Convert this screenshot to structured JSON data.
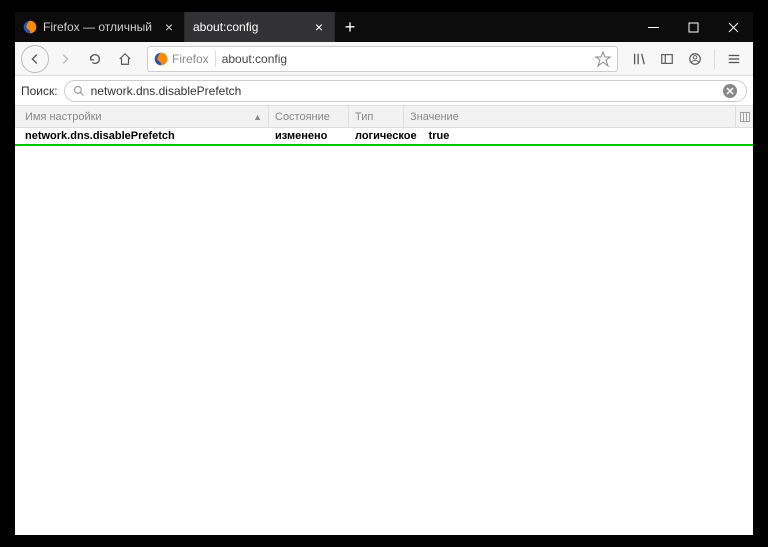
{
  "window": {
    "tabs": [
      {
        "title": "Firefox — отличный браузер",
        "favicon": "firefox"
      },
      {
        "title": "about:config",
        "favicon": "none"
      }
    ],
    "active_tab": 1
  },
  "navbar": {
    "url_identity": "Firefox",
    "url": "about:config"
  },
  "config": {
    "search_label": "Поиск:",
    "search_value": "network.dns.disablePrefetch",
    "columns": {
      "name": "Имя настройки",
      "status": "Состояние",
      "type": "Тип",
      "value": "Значение"
    },
    "rows": [
      {
        "name": "network.dns.disablePrefetch",
        "status": "изменено",
        "type": "логическое",
        "value": "true"
      }
    ]
  }
}
